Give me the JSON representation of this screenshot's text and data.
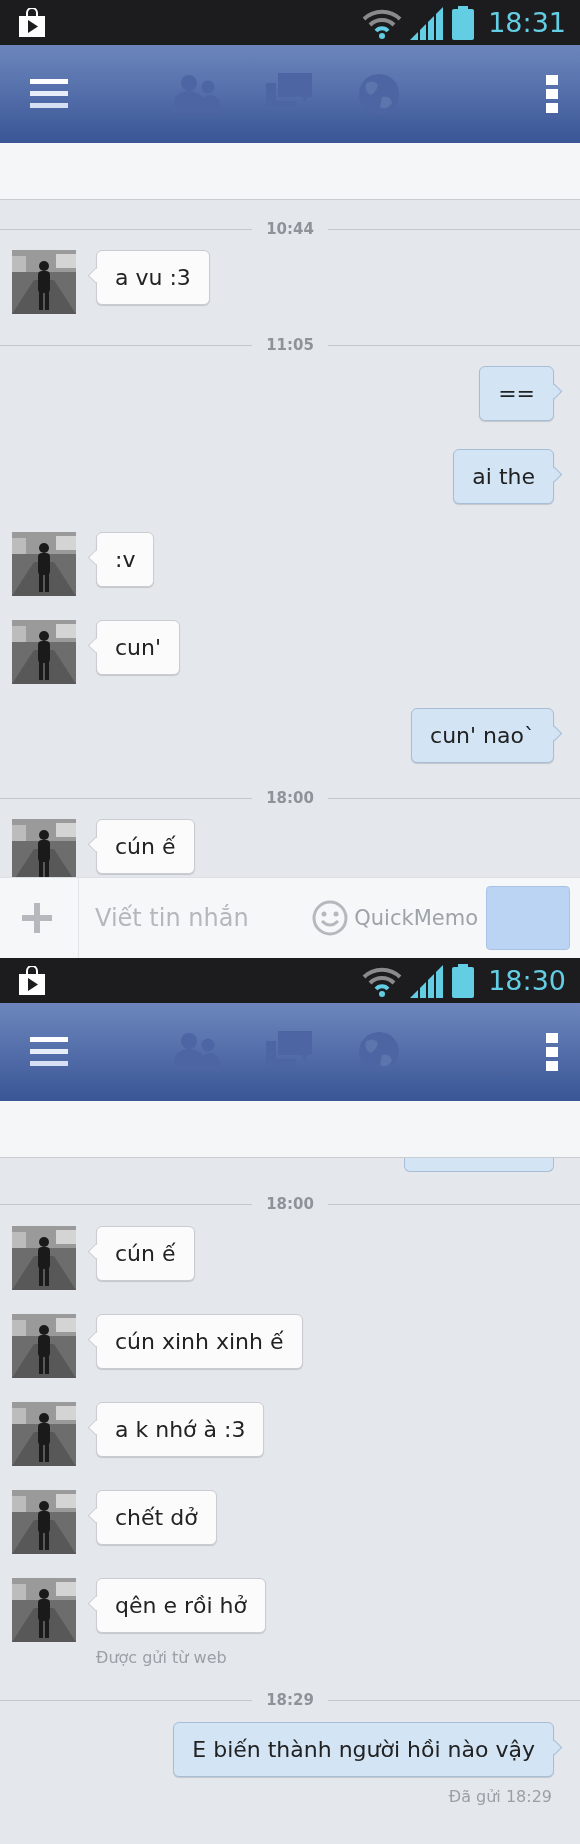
{
  "screens": [
    {
      "status_bar": {
        "time": "18:31"
      },
      "messages": [
        {
          "kind": "divider",
          "text": "10:44"
        },
        {
          "kind": "bubble",
          "outgoing": false,
          "text": "a vu  :3"
        },
        {
          "kind": "divider",
          "text": "11:05"
        },
        {
          "kind": "bubble",
          "outgoing": true,
          "text": "=="
        },
        {
          "kind": "bubble",
          "outgoing": true,
          "text": "ai the"
        },
        {
          "kind": "bubble",
          "outgoing": false,
          "text": ":v"
        },
        {
          "kind": "bubble",
          "outgoing": false,
          "text": "cun'"
        },
        {
          "kind": "bubble",
          "outgoing": true,
          "text": "cun' nao`"
        },
        {
          "kind": "divider",
          "text": "18:00"
        },
        {
          "kind": "bubble",
          "outgoing": false,
          "text": "cún ế"
        }
      ],
      "composer": {
        "placeholder": "Viết tin nhắn",
        "overlay": "QuickMemo"
      }
    },
    {
      "status_bar": {
        "time": "18:30"
      },
      "messages": [
        {
          "kind": "stub",
          "outgoing": true
        },
        {
          "kind": "divider",
          "text": "18:00"
        },
        {
          "kind": "bubble",
          "outgoing": false,
          "text": "cún ế"
        },
        {
          "kind": "bubble",
          "outgoing": false,
          "text": "cún xinh xinh ế"
        },
        {
          "kind": "bubble",
          "outgoing": false,
          "text": "a k nhớ à :3"
        },
        {
          "kind": "bubble",
          "outgoing": false,
          "text": "chết dở"
        },
        {
          "kind": "bubble",
          "outgoing": false,
          "text": "qên e rồi hở"
        },
        {
          "kind": "note",
          "outgoing": false,
          "text": "Được gửi từ web"
        },
        {
          "kind": "divider",
          "text": "18:29"
        },
        {
          "kind": "bubble",
          "outgoing": true,
          "text": "E biến thành người hồi nào vậy"
        },
        {
          "kind": "note",
          "outgoing": true,
          "text": "Đã gửi 18:29"
        }
      ]
    }
  ]
}
